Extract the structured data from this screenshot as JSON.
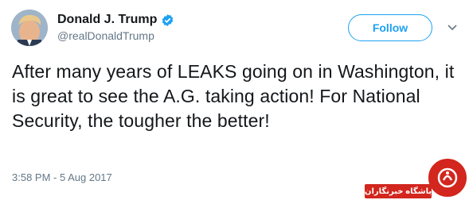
{
  "user": {
    "display_name": "Donald J. Trump",
    "handle": "@realDonaldTrump",
    "verified": true
  },
  "actions": {
    "follow_label": "Follow",
    "more_icon": "chevron-down-icon"
  },
  "tweet": {
    "text": "After many years of LEAKS going on in Washington, it is great to see the A.G. taking action! For National Security, the tougher the better!",
    "timestamp": "3:58 PM - 5 Aug 2017"
  },
  "watermark": {
    "label": "باشگاه خبرنگاران",
    "color": "#d2261e"
  },
  "colors": {
    "accent": "#1da1f2",
    "text": "#14171a",
    "secondary": "#657786"
  }
}
